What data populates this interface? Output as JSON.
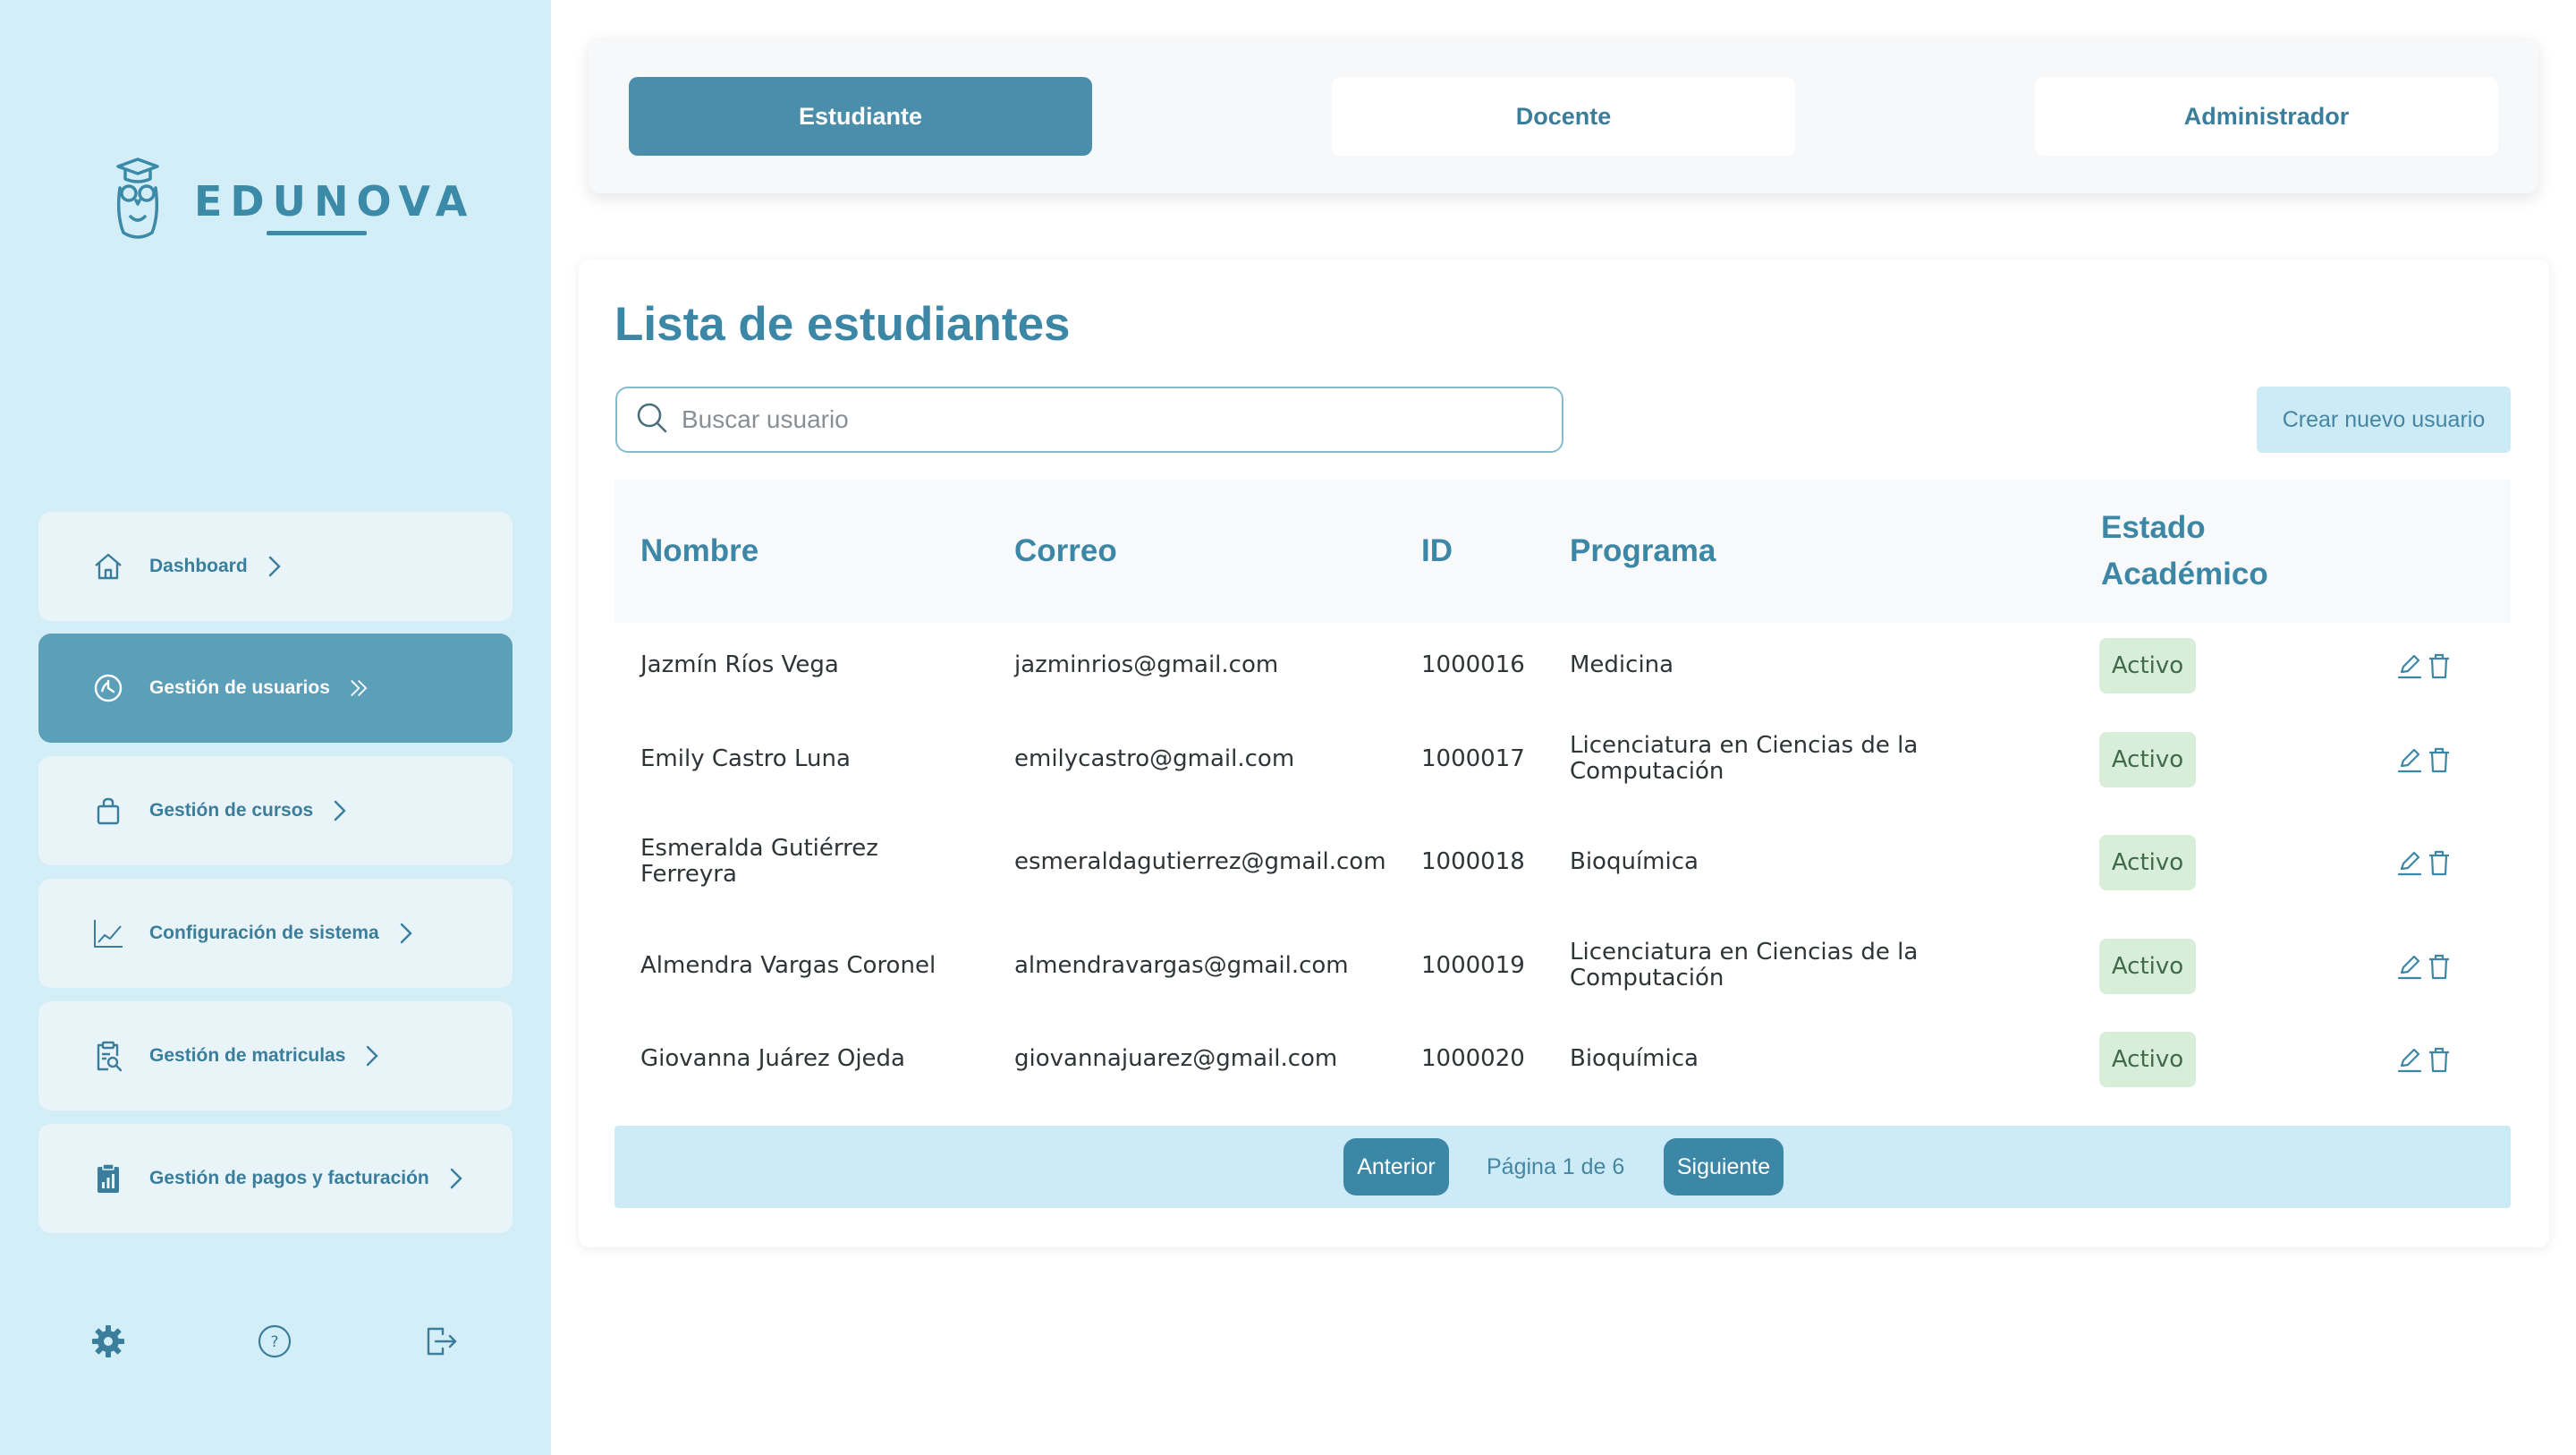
{
  "brand": {
    "name": "EDUNOVA"
  },
  "sidebar": {
    "items": [
      {
        "label": "Dashboard",
        "icon": "home-icon"
      },
      {
        "label": "Gestión de usuarios",
        "icon": "users-icon",
        "active": true
      },
      {
        "label": "Gestión de cursos",
        "icon": "bag-icon"
      },
      {
        "label": "Configuración de sistema",
        "icon": "chart-icon"
      },
      {
        "label": "Gestión de matriculas",
        "icon": "clipboard-search-icon"
      },
      {
        "label": "Gestión de pagos y facturación",
        "icon": "clipboard-bars-icon"
      }
    ],
    "footer": [
      "gear-icon",
      "help-icon",
      "logout-icon"
    ]
  },
  "roles": {
    "tabs": [
      {
        "label": "Estudiante",
        "active": true
      },
      {
        "label": "Docente"
      },
      {
        "label": "Administrador"
      }
    ]
  },
  "main": {
    "title": "Lista de estudiantes",
    "search_placeholder": "Buscar usuario",
    "create_label": "Crear nuevo usuario",
    "columns": {
      "nombre": "Nombre",
      "correo": "Correo",
      "id": "ID",
      "programa": "Programa",
      "estado_1": "Estado",
      "estado_2": "Académico"
    },
    "rows": [
      {
        "nombre": "Jazmín Ríos Vega",
        "correo": "jazminrios@gmail.com",
        "id": "1000016",
        "programa": "Medicina",
        "estado": "Activo"
      },
      {
        "nombre": "Emily Castro Luna",
        "correo": "emilycastro@gmail.com",
        "id": "1000017",
        "programa": "Licenciatura en Ciencias de la Computación",
        "estado": "Activo"
      },
      {
        "nombre": "Esmeralda Gutiérrez Ferreyra",
        "correo": "esmeraldagutierrez@gmail.com",
        "id": "1000018",
        "programa": "Bioquímica",
        "estado": "Activo"
      },
      {
        "nombre": "Almendra Vargas Coronel",
        "correo": "almendravargas@gmail.com",
        "id": "1000019",
        "programa": "Licenciatura en Ciencias de la Computación",
        "estado": "Activo"
      },
      {
        "nombre": "Giovanna Juárez Ojeda",
        "correo": "giovannajuarez@gmail.com",
        "id": "1000020",
        "programa": "Bioquímica",
        "estado": "Activo"
      }
    ],
    "pagination": {
      "prev": "Anterior",
      "page_text": "Página 1 de 6",
      "next": "Siguiente"
    }
  },
  "colors": {
    "accent": "#3d87a6",
    "sidebar_bg": "#d4eef8",
    "badge_bg": "#d8eed8"
  }
}
